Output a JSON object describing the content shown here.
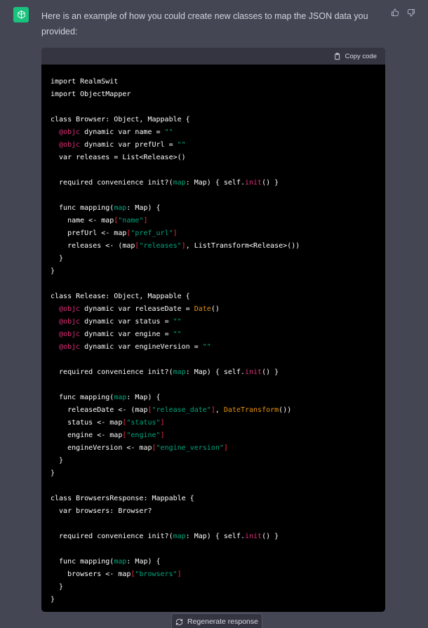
{
  "message": {
    "intro_text": "Here is an example of how you could create new classes to map the JSON data you provided:",
    "feedback": {
      "thumbs_up_icon": "thumbs-up-icon",
      "thumbs_down_icon": "thumbs-down-icon"
    },
    "avatar_icon": "openai-logo-icon"
  },
  "code_block": {
    "copy_label": "Copy code",
    "copy_icon": "clipboard-icon",
    "lines": [
      [
        {
          "t": "import RealmSwit"
        }
      ],
      [
        {
          "t": "import ObjectMapper"
        }
      ],
      [],
      [
        {
          "t": "class Browser: Object, Mappable {"
        }
      ],
      [
        {
          "t": "  "
        },
        {
          "t": "@objc",
          "c": "deco"
        },
        {
          "t": " dynamic var name = "
        },
        {
          "t": "\"\"",
          "c": "str"
        }
      ],
      [
        {
          "t": "  "
        },
        {
          "t": "@objc",
          "c": "deco"
        },
        {
          "t": " dynamic var prefUrl = "
        },
        {
          "t": "\"\"",
          "c": "str"
        }
      ],
      [
        {
          "t": "  var releases = List<Release>()"
        }
      ],
      [],
      [
        {
          "t": "  required convenience init?("
        },
        {
          "t": "map",
          "c": "str"
        },
        {
          "t": ": Map) { self."
        },
        {
          "t": "init",
          "c": "self"
        },
        {
          "t": "() }"
        }
      ],
      [],
      [
        {
          "t": "  func mapping("
        },
        {
          "t": "map",
          "c": "str"
        },
        {
          "t": ": Map) {"
        }
      ],
      [
        {
          "t": "    name <- map"
        },
        {
          "t": "[",
          "c": "type"
        },
        {
          "t": "\"name\"",
          "c": "str"
        },
        {
          "t": "]",
          "c": "type"
        }
      ],
      [
        {
          "t": "    prefUrl <- map"
        },
        {
          "t": "[",
          "c": "type"
        },
        {
          "t": "\"pref_url\"",
          "c": "str"
        },
        {
          "t": "]",
          "c": "type"
        }
      ],
      [
        {
          "t": "    releases <- (map"
        },
        {
          "t": "[",
          "c": "type"
        },
        {
          "t": "\"releases\"",
          "c": "str"
        },
        {
          "t": "]",
          "c": "type"
        },
        {
          "t": ", ListTransform<Release>())"
        }
      ],
      [
        {
          "t": "  }"
        }
      ],
      [
        {
          "t": "}"
        }
      ],
      [],
      [
        {
          "t": "class Release: Object, Mappable {"
        }
      ],
      [
        {
          "t": "  "
        },
        {
          "t": "@objc",
          "c": "deco"
        },
        {
          "t": " dynamic var releaseDate = "
        },
        {
          "t": "Date",
          "c": "cls"
        },
        {
          "t": "()"
        }
      ],
      [
        {
          "t": "  "
        },
        {
          "t": "@objc",
          "c": "deco"
        },
        {
          "t": " dynamic var status = "
        },
        {
          "t": "\"\"",
          "c": "str"
        }
      ],
      [
        {
          "t": "  "
        },
        {
          "t": "@objc",
          "c": "deco"
        },
        {
          "t": " dynamic var engine = "
        },
        {
          "t": "\"\"",
          "c": "str"
        }
      ],
      [
        {
          "t": "  "
        },
        {
          "t": "@objc",
          "c": "deco"
        },
        {
          "t": " dynamic var engineVersion = "
        },
        {
          "t": "\"\"",
          "c": "str"
        }
      ],
      [],
      [
        {
          "t": "  required convenience init?("
        },
        {
          "t": "map",
          "c": "str"
        },
        {
          "t": ": Map) { self."
        },
        {
          "t": "init",
          "c": "self"
        },
        {
          "t": "() }"
        }
      ],
      [],
      [
        {
          "t": "  func mapping("
        },
        {
          "t": "map",
          "c": "str"
        },
        {
          "t": ": Map) {"
        }
      ],
      [
        {
          "t": "    releaseDate <- (map"
        },
        {
          "t": "[",
          "c": "type"
        },
        {
          "t": "\"release_date\"",
          "c": "str"
        },
        {
          "t": "]",
          "c": "type"
        },
        {
          "t": ", "
        },
        {
          "t": "DateTransform",
          "c": "cls"
        },
        {
          "t": "())"
        }
      ],
      [
        {
          "t": "    status <- map"
        },
        {
          "t": "[",
          "c": "type"
        },
        {
          "t": "\"status\"",
          "c": "str"
        },
        {
          "t": "]",
          "c": "type"
        }
      ],
      [
        {
          "t": "    engine <- map"
        },
        {
          "t": "[",
          "c": "type"
        },
        {
          "t": "\"engine\"",
          "c": "str"
        },
        {
          "t": "]",
          "c": "type"
        }
      ],
      [
        {
          "t": "    engineVersion <- map"
        },
        {
          "t": "[",
          "c": "type"
        },
        {
          "t": "\"engine_version\"",
          "c": "str"
        },
        {
          "t": "]",
          "c": "type"
        }
      ],
      [
        {
          "t": "  }"
        }
      ],
      [
        {
          "t": "}"
        }
      ],
      [],
      [
        {
          "t": "class BrowsersResponse: Mappable {"
        }
      ],
      [
        {
          "t": "  var browsers: Browser?"
        }
      ],
      [],
      [
        {
          "t": "  required convenience init?("
        },
        {
          "t": "map",
          "c": "str"
        },
        {
          "t": ": Map) { self."
        },
        {
          "t": "init",
          "c": "self"
        },
        {
          "t": "() }"
        }
      ],
      [],
      [
        {
          "t": "  func mapping("
        },
        {
          "t": "map",
          "c": "str"
        },
        {
          "t": ": Map) {"
        }
      ],
      [
        {
          "t": "    browsers <- map"
        },
        {
          "t": "[",
          "c": "type"
        },
        {
          "t": "\"browsers\"",
          "c": "str"
        },
        {
          "t": "]",
          "c": "type"
        }
      ],
      [
        {
          "t": "  }"
        }
      ],
      [
        {
          "t": "}"
        }
      ]
    ]
  },
  "footer": {
    "regenerate_label": "Regenerate response",
    "regenerate_icon": "refresh-icon"
  },
  "colors": {
    "page_bg": "#444654",
    "code_bg": "#000000",
    "code_header_bg": "#343541",
    "avatar_bg": "#19c37d",
    "keyword_pink": "#df3079",
    "string_green": "#00a67d",
    "class_orange": "#e9950c"
  }
}
